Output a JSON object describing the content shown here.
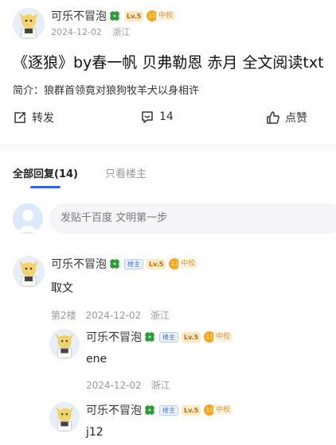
{
  "post": {
    "author": "可乐不冒泡",
    "level": "Lv.5",
    "tier_badge": "11",
    "tier_label": "中校",
    "date": "2024-12-02",
    "location": "浙江",
    "title": "《逐狼》by春一帆 贝弗勒恩 赤月 全文阅读txt",
    "summary": "简介：狼群首领竟对狼狗牧羊犬以身相许"
  },
  "actions": {
    "forward_label": "转发",
    "comment_count": "14",
    "like_label": "点赞"
  },
  "tabs": [
    {
      "label": "全部回复(14)",
      "active": true
    },
    {
      "label": "只看楼主",
      "active": false
    }
  ],
  "reply_box": {
    "placeholder": "发贴千百度 文明第一步"
  },
  "comments": [
    {
      "author": "可乐不冒泡",
      "floor_tag": "楼主",
      "level": "Lv.5",
      "tier_badge": "11",
      "tier_label": "中校",
      "text": "取文",
      "floor": "第2楼",
      "date": "2024-12-02",
      "location": "浙江"
    },
    {
      "author": "可乐不冒泡",
      "floor_tag": "楼主",
      "level": "Lv.5",
      "tier_badge": "11",
      "tier_label": "中校",
      "text": "ene",
      "date": "2024-12-02",
      "location": "浙江"
    },
    {
      "author": "可乐不冒泡",
      "floor_tag": "楼主",
      "level": "Lv.5",
      "tier_badge": "11",
      "tier_label": "中校",
      "text": "j12"
    }
  ],
  "colors": {
    "accent": "#3167ea",
    "level_bg": "#fde9c8",
    "tier_gold": "#f5a623",
    "clover_green": "#2e9b3a"
  },
  "icons": [
    "forward-icon",
    "comment-icon",
    "like-icon",
    "clover-icon",
    "tier-badge-icon",
    "avatar-image"
  ]
}
